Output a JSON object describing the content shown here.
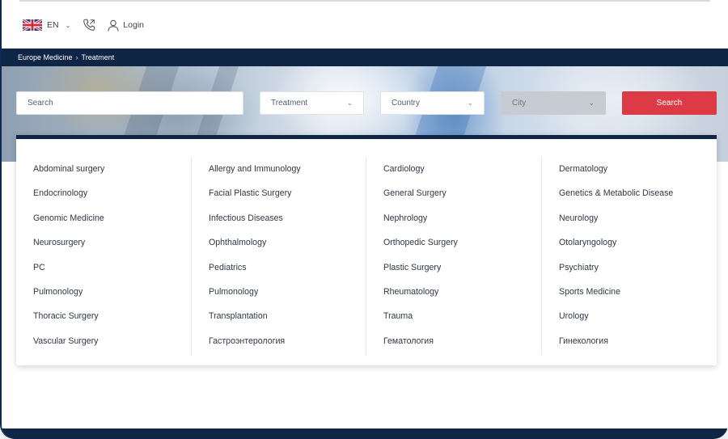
{
  "header": {
    "language": "EN",
    "login_label": "Login"
  },
  "breadcrumb": [
    "Europe Medicine",
    "Treatment"
  ],
  "search": {
    "search_placeholder": "Search",
    "treatment_label": "Treatment",
    "country_label": "Country",
    "city_label": "City",
    "button_label": "Search"
  },
  "dropdown": {
    "columns": [
      [
        "Abdominal surgery",
        "Endocrinology",
        "Genomic Medicine",
        "Neurosurgery",
        "PC",
        "Pulmonology",
        "Thoracic Surgery",
        "Vascular Surgery"
      ],
      [
        "Allergy and Immunology",
        "Facial Plastic Surgery",
        "Infectious Diseases",
        "Ophthalmology",
        "Pediatrics",
        "Pulmonology",
        "Transplantation",
        "Гастроэнтерология"
      ],
      [
        "Cardiology",
        "General Surgery",
        "Nephrology",
        "Orthopedic Surgery",
        "Plastic Surgery",
        "Rheumatology",
        "Trauma",
        "Гематология"
      ],
      [
        "Dermatology",
        "Genetics & Metabolic Disease",
        "Neurology",
        "Otolaryngology",
        "Psychiatry",
        "Sports Medicine",
        "Urology",
        "Гинекология"
      ]
    ]
  },
  "colors": {
    "navy": "#0e2545",
    "accent_red": "#dc3a45",
    "disabled_grey": "#c7ccd2"
  },
  "icons": [
    "uk-flag-icon",
    "chevron-down-icon",
    "phone-icon",
    "user-icon"
  ]
}
